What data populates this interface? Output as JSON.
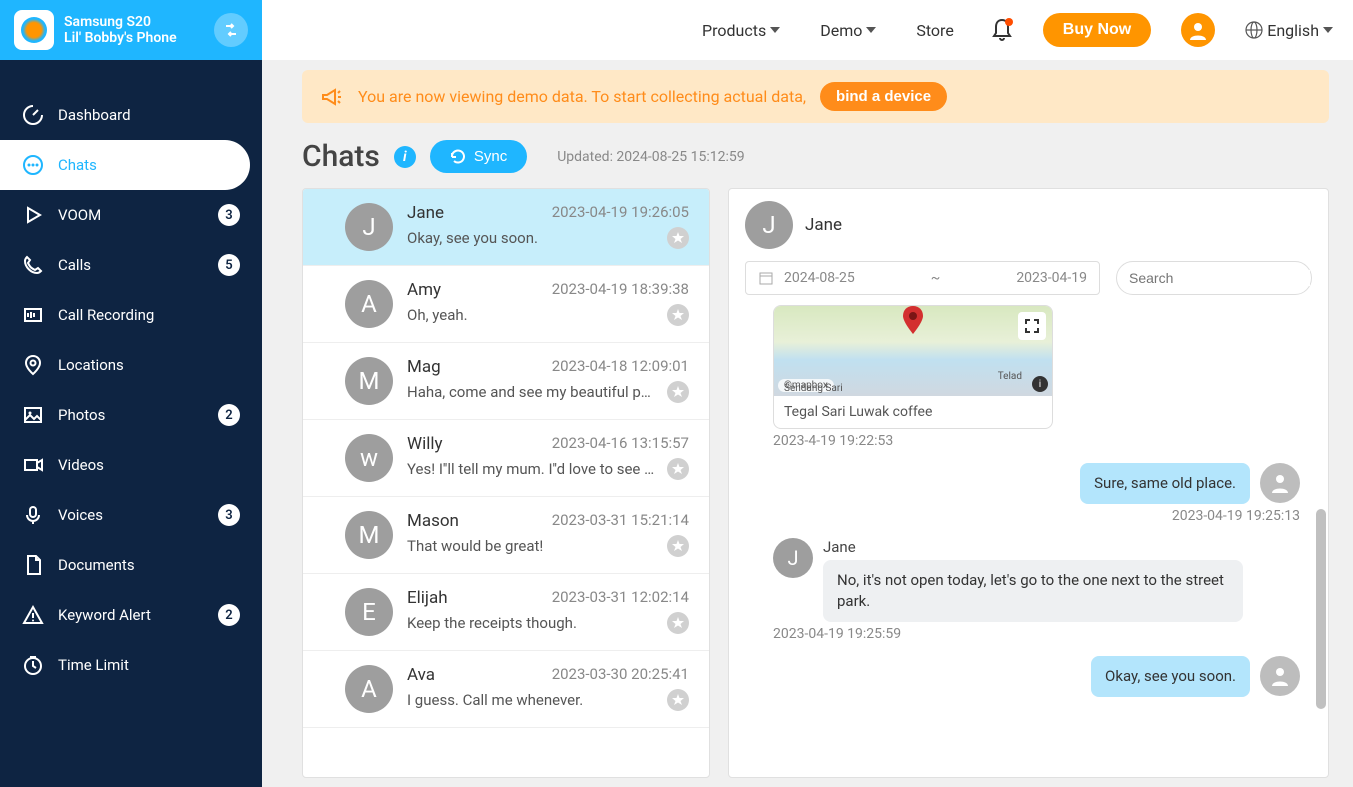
{
  "header": {
    "nav": [
      "Products",
      "Demo",
      "Store"
    ],
    "buy": "Buy Now",
    "lang": "English"
  },
  "device": {
    "name": "Samsung S20",
    "sub": "Lil' Bobby's Phone"
  },
  "sidebar": {
    "items": [
      {
        "label": "Dashboard",
        "badge": null
      },
      {
        "label": "Chats",
        "badge": null
      },
      {
        "label": "VOOM",
        "badge": "3"
      },
      {
        "label": "Calls",
        "badge": "5"
      },
      {
        "label": "Call Recording",
        "badge": null
      },
      {
        "label": "Locations",
        "badge": null
      },
      {
        "label": "Photos",
        "badge": "2"
      },
      {
        "label": "Videos",
        "badge": null
      },
      {
        "label": "Voices",
        "badge": "3"
      },
      {
        "label": "Documents",
        "badge": null
      },
      {
        "label": "Keyword Alert",
        "badge": "2"
      },
      {
        "label": "Time Limit",
        "badge": null
      }
    ]
  },
  "banner": {
    "text": "You are now viewing demo data. To start collecting actual data, ",
    "action": "bind a device"
  },
  "page": {
    "title": "Chats",
    "sync": "Sync",
    "updated": "Updated: 2024-08-25 15:12:59"
  },
  "chats": [
    {
      "initial": "J",
      "name": "Jane",
      "time": "2023-04-19 19:26:05",
      "preview": "Okay, see you soon."
    },
    {
      "initial": "A",
      "name": "Amy",
      "time": "2023-04-19 18:39:38",
      "preview": "Oh, yeah."
    },
    {
      "initial": "M",
      "name": "Mag",
      "time": "2023-04-18 12:09:01",
      "preview": "Haha, come and see my beautiful pup..."
    },
    {
      "initial": "w",
      "name": "Willy",
      "time": "2023-04-16 13:15:57",
      "preview": "Yes! I''ll tell my mum. I''d love to see th..."
    },
    {
      "initial": "M",
      "name": "Mason",
      "time": "2023-03-31 15:21:14",
      "preview": "That would be great!"
    },
    {
      "initial": "E",
      "name": "Elijah",
      "time": "2023-03-31 12:02:14",
      "preview": "Keep the receipts though."
    },
    {
      "initial": "A",
      "name": "Ava",
      "time": "2023-03-30 20:25:41",
      "preview": "I guess. Call me whenever."
    }
  ],
  "detail": {
    "name": "Jane",
    "initial": "J",
    "date_from": "2024-08-25",
    "date_to": "2023-04-19",
    "search_ph": "Search",
    "map_caption": "Tegal Sari Luwak coffee",
    "map_attr": "©mapbox",
    "map_loc1": "Sendang Sari",
    "map_loc2": "Telad",
    "map_time": "2023-4-19 19:22:53",
    "messages": [
      {
        "dir": "out",
        "text": "Sure, same old place.",
        "time": "2023-04-19 19:25:13"
      },
      {
        "dir": "in",
        "name": "Jane",
        "initial": "J",
        "text": "No, it's not open today, let's go to the one next to the street park.",
        "time": "2023-04-19 19:25:59"
      },
      {
        "dir": "out",
        "text": "Okay, see you soon.",
        "time": ""
      }
    ]
  }
}
